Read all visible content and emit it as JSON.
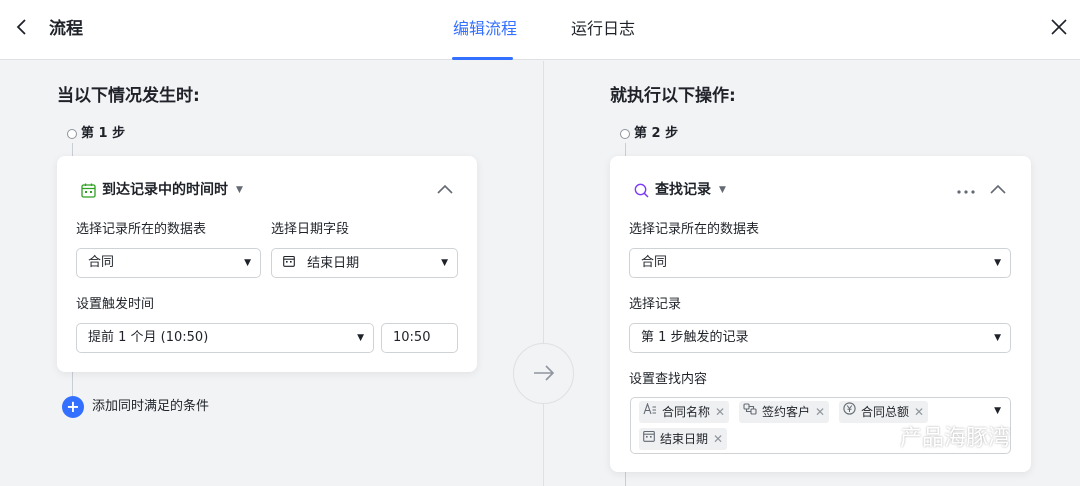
{
  "header": {
    "back_icon": "chevron-left-icon",
    "title": "流程",
    "tabs": [
      {
        "label": "编辑流程",
        "active": true
      },
      {
        "label": "运行日志",
        "active": false
      }
    ],
    "close_icon": "close-icon"
  },
  "left": {
    "section_title": "当以下情况发生时:",
    "step_label": "第 1 步",
    "trigger": {
      "icon": "calendar-icon",
      "title": "到达记录中的时间时",
      "table_label": "选择记录所在的数据表",
      "table_value": "合同",
      "date_field_label": "选择日期字段",
      "date_field_value": "结束日期",
      "time_label": "设置触发时间",
      "time_value": "提前 1 个月 (10:50)",
      "time_input": "10:50"
    },
    "add_condition": "添加同时满足的条件"
  },
  "right": {
    "section_title": "就执行以下操作:",
    "step_label": "第 2 步",
    "action": {
      "icon": "search-icon",
      "title": "查找记录",
      "table_label": "选择记录所在的数据表",
      "table_value": "合同",
      "record_label": "选择记录",
      "record_value": "第 1 步触发的记录",
      "content_label": "设置查找内容",
      "fields": [
        {
          "icon": "text-field-icon",
          "label": "合同名称"
        },
        {
          "icon": "link-field-icon",
          "label": "签约客户"
        },
        {
          "icon": "currency-field-icon",
          "label": "合同总额"
        },
        {
          "icon": "date-field-icon",
          "label": "结束日期"
        }
      ]
    }
  },
  "watermark": "产品海豚湾",
  "colors": {
    "accent": "#3370ff",
    "trigger_icon": "#2ea121",
    "action_icon": "#7f3bf5"
  }
}
